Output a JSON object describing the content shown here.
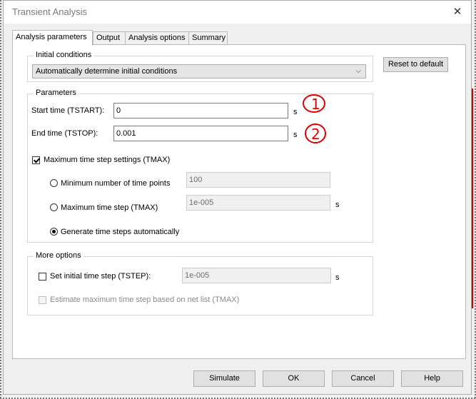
{
  "window": {
    "title": "Transient Analysis",
    "close_icon": "close-icon"
  },
  "tabs": [
    {
      "label": "Analysis parameters",
      "active": true
    },
    {
      "label": "Output",
      "active": false
    },
    {
      "label": "Analysis options",
      "active": false
    },
    {
      "label": "Summary",
      "active": false
    }
  ],
  "initial_conditions": {
    "legend": "Initial conditions",
    "selected": "Automatically determine initial conditions"
  },
  "reset_button": "Reset to default",
  "parameters": {
    "legend": "Parameters",
    "start_time": {
      "label": "Start time (TSTART):",
      "value": "0",
      "unit": "s"
    },
    "end_time": {
      "label": "End time (TSTOP):",
      "value": "0.001",
      "unit": "s"
    },
    "tmax_settings": {
      "label": "Maximum time step settings (TMAX)",
      "checked": true
    },
    "min_points": {
      "label": "Minimum number of time points",
      "value": "100",
      "selected": false
    },
    "max_step": {
      "label": "Maximum time step (TMAX)",
      "value": "1e-005",
      "unit": "s",
      "selected": false
    },
    "auto_steps": {
      "label": "Generate time steps automatically",
      "selected": true
    }
  },
  "more_options": {
    "legend": "More options",
    "initial_step": {
      "label": "Set initial time step (TSTEP):",
      "value": "1e-005",
      "unit": "s",
      "checked": false
    },
    "estimate_step": {
      "label": "Estimate maximum time step based on net list (TMAX)",
      "checked": false,
      "enabled": false
    }
  },
  "footer": {
    "simulate": "Simulate",
    "ok": "OK",
    "cancel": "Cancel",
    "help": "Help"
  },
  "annotations": {
    "one": "1",
    "two": "2",
    "color": "#e00000"
  }
}
